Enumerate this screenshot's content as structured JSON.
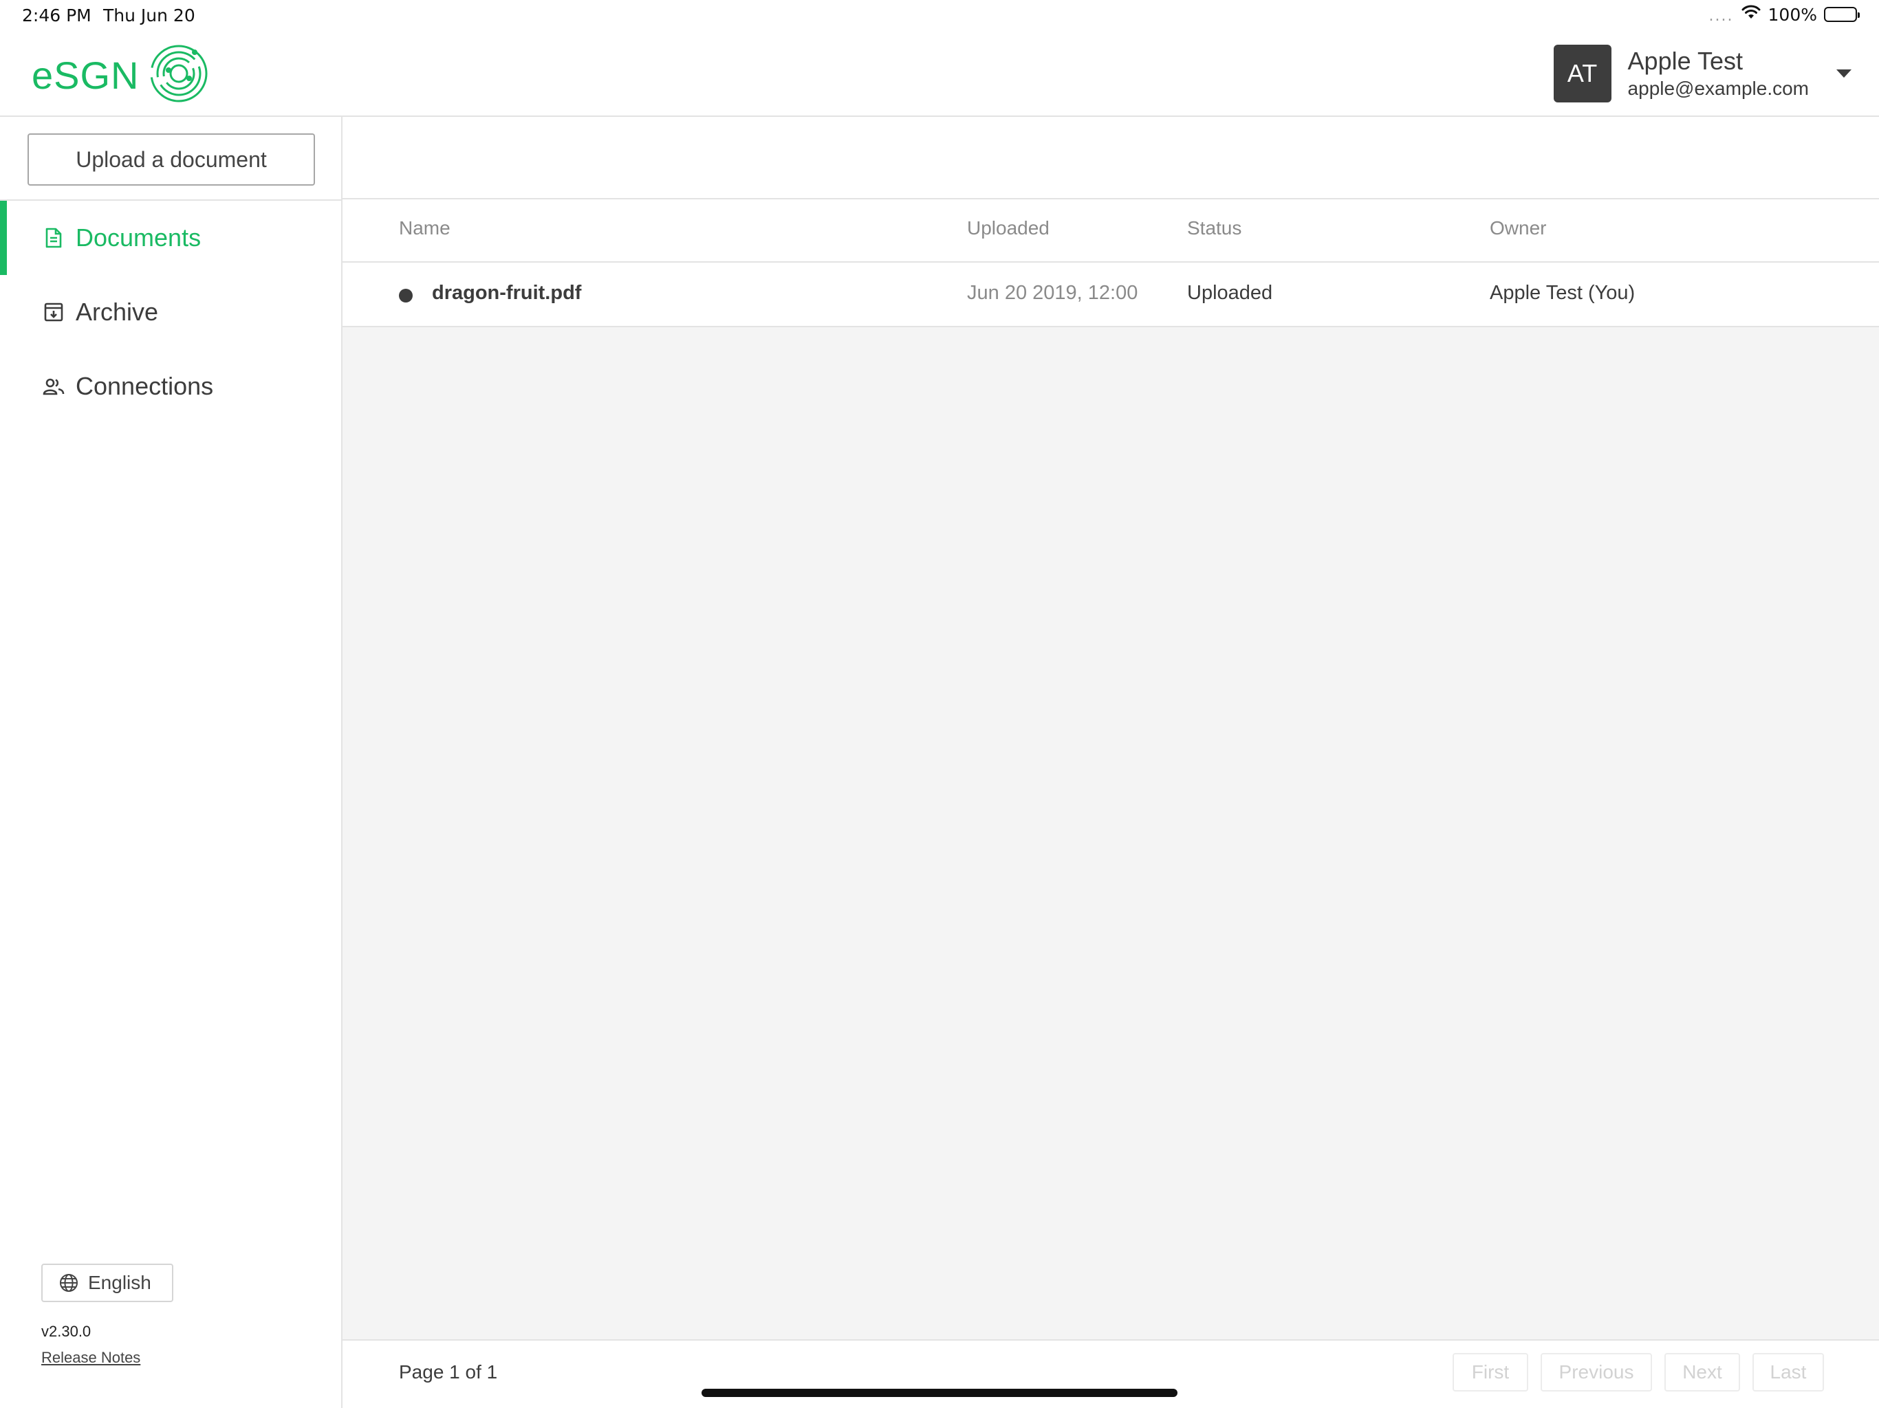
{
  "status_bar": {
    "time": "2:46 PM",
    "date": "Thu Jun 20",
    "signal": "....",
    "battery": "100%",
    "battery_level": 1.0
  },
  "header": {
    "logo_text": "eSGN",
    "logo_icon": "esgn-orbit-logo",
    "user": {
      "initials": "AT",
      "name": "Apple Test",
      "email": "apple@example.com"
    }
  },
  "sidebar": {
    "upload_label": "Upload a document",
    "items": [
      {
        "label": "Documents",
        "icon": "document-icon",
        "active": true
      },
      {
        "label": "Archive",
        "icon": "archive-icon",
        "active": false
      },
      {
        "label": "Connections",
        "icon": "people-icon",
        "active": false
      }
    ],
    "language": "English",
    "version": "v2.30.0",
    "release_notes": "Release Notes"
  },
  "table": {
    "columns": [
      "Name",
      "Uploaded",
      "Status",
      "Owner"
    ],
    "rows": [
      {
        "name": "dragon-fruit.pdf",
        "uploaded": "Jun 20 2019, 12:00",
        "status": "Uploaded",
        "owner": "Apple Test (You)"
      }
    ]
  },
  "pagination": {
    "page_info": "Page 1 of 1",
    "buttons": [
      "First",
      "Previous",
      "Next",
      "Last"
    ]
  },
  "colors": {
    "accent": "#1aba63",
    "avatar_bg": "#3d3d3d",
    "content_bg": "#f4f4f4"
  }
}
